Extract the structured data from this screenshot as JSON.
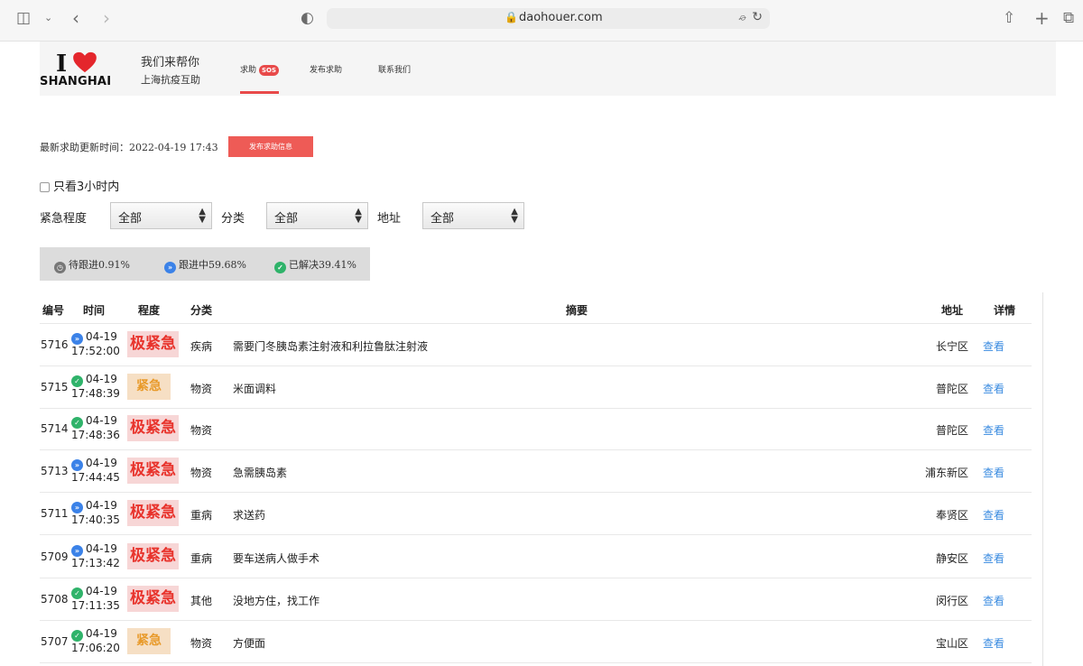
{
  "browser": {
    "url": "daohouer.com"
  },
  "site": {
    "logo_line2": "SHANGHAI",
    "slogan1": "我们来帮你",
    "slogan2": "上海抗疫互助",
    "nav": {
      "help": "求助",
      "sos": "SOS",
      "post": "发布求助",
      "contact": "联系我们"
    }
  },
  "toolbar": {
    "update_text": "最新求助更新时间：2022-04-19 17:43",
    "post_button": "发布求助信息",
    "only3h": "只看3小时内"
  },
  "filters": {
    "urgency_label": "紧急程度",
    "urgency_value": "全部",
    "category_label": "分类",
    "category_value": "全部",
    "address_label": "地址",
    "address_value": "全部"
  },
  "stats": {
    "pending": "待跟进0.91%",
    "following": "跟进中59.68%",
    "resolved": "已解决39.41%"
  },
  "colors": {
    "accent": "#e84a4a",
    "following": "#3b82e8",
    "resolved": "#2fb36a",
    "pending": "#777777",
    "link": "#3a8be0"
  },
  "table": {
    "headers": {
      "id": "编号",
      "time": "时间",
      "level": "程度",
      "category": "分类",
      "summary": "摘要",
      "address": "地址",
      "detail": "详情"
    },
    "rows": [
      {
        "id": "5716",
        "status": "following",
        "date": "04-19",
        "time": "17:52:00",
        "level": "极紧急",
        "level_type": "crit",
        "category": "疾病",
        "summary": "需要门冬胰岛素注射液和利拉鲁肽注射液",
        "address": "长宁区",
        "detail": "查看"
      },
      {
        "id": "5715",
        "status": "resolved",
        "date": "04-19",
        "time": "17:48:39",
        "level": "紧急",
        "level_type": "urg",
        "category": "物资",
        "summary": "米面调料",
        "address": "普陀区",
        "detail": "查看"
      },
      {
        "id": "5714",
        "status": "resolved",
        "date": "04-19",
        "time": "17:48:36",
        "level": "极紧急",
        "level_type": "crit",
        "category": "物资",
        "summary": "",
        "address": "普陀区",
        "detail": "查看"
      },
      {
        "id": "5713",
        "status": "following",
        "date": "04-19",
        "time": "17:44:45",
        "level": "极紧急",
        "level_type": "crit",
        "category": "物资",
        "summary": "急需胰岛素",
        "address": "浦东新区",
        "detail": "查看"
      },
      {
        "id": "5711",
        "status": "following",
        "date": "04-19",
        "time": "17:40:35",
        "level": "极紧急",
        "level_type": "crit",
        "category": "重病",
        "summary": "求送药",
        "address": "奉贤区",
        "detail": "查看"
      },
      {
        "id": "5709",
        "status": "following",
        "date": "04-19",
        "time": "17:13:42",
        "level": "极紧急",
        "level_type": "crit",
        "category": "重病",
        "summary": "要车送病人做手术",
        "address": "静安区",
        "detail": "查看"
      },
      {
        "id": "5708",
        "status": "resolved",
        "date": "04-19",
        "time": "17:11:35",
        "level": "极紧急",
        "level_type": "crit",
        "category": "其他",
        "summary": "没地方住，找工作",
        "address": "闵行区",
        "detail": "查看"
      },
      {
        "id": "5707",
        "status": "resolved",
        "date": "04-19",
        "time": "17:06:20",
        "level": "紧急",
        "level_type": "urg",
        "category": "物资",
        "summary": "方便面",
        "address": "宝山区",
        "detail": "查看"
      }
    ]
  }
}
